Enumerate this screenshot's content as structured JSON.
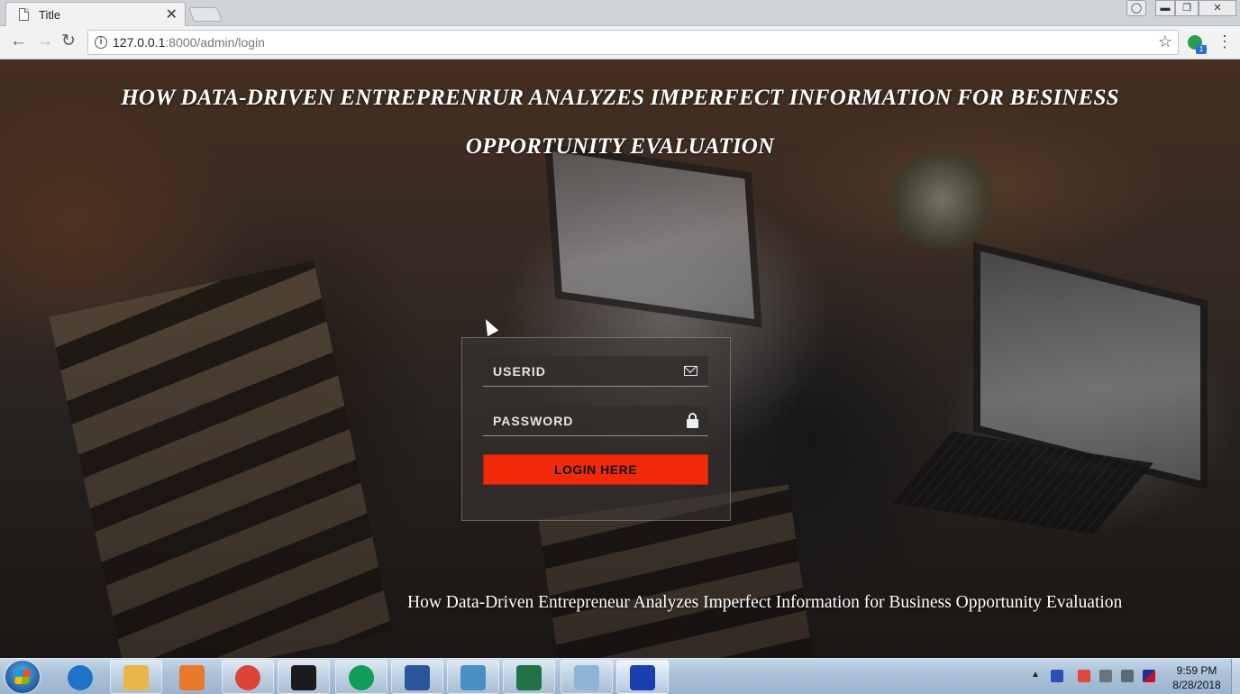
{
  "browser": {
    "tab_title": "Title",
    "tab_close": "✕",
    "url_host": "127.0.0.1",
    "url_rest": ":8000/admin/login",
    "ext_badge": "1",
    "nav_back": "←",
    "nav_forward": "→",
    "nav_reload": "↻",
    "bookmark_star": "☆",
    "menu": "⋮",
    "window_user": "◯",
    "window_min": "▬",
    "window_max": "❐",
    "window_close": "✕"
  },
  "page": {
    "title": "HOW DATA-DRIVEN ENTREPRENRUR ANALYZES IMPERFECT INFORMATION FOR BESINESS OPPORTUNITY EVALUATION",
    "footer": "How Data-Driven Entrepreneur Analyzes Imperfect Information for Business Opportunity Evaluation"
  },
  "login": {
    "userid_placeholder": "USERID",
    "password_placeholder": "PASSWORD",
    "button_label": "LOGIN HERE"
  },
  "taskbar": {
    "apps": [
      {
        "name": "internet-explorer",
        "color": "#1e73c8"
      },
      {
        "name": "file-explorer",
        "color": "#e6b84a"
      },
      {
        "name": "media-player",
        "color": "#e8792a"
      },
      {
        "name": "chrome",
        "color": "#db4437"
      },
      {
        "name": "pycharm",
        "color": "#1b1b1b"
      },
      {
        "name": "hangouts",
        "color": "#0f9d58"
      },
      {
        "name": "word",
        "color": "#2b579a"
      },
      {
        "name": "photo-viewer",
        "color": "#4a8fc4"
      },
      {
        "name": "excel",
        "color": "#217346"
      },
      {
        "name": "notepad",
        "color": "#8fb5d6"
      },
      {
        "name": "remote-desktop",
        "color": "#1a3fb0"
      }
    ],
    "tray_arrow": "▲",
    "clock_time": "9:59 PM",
    "clock_date": "8/28/2018"
  }
}
